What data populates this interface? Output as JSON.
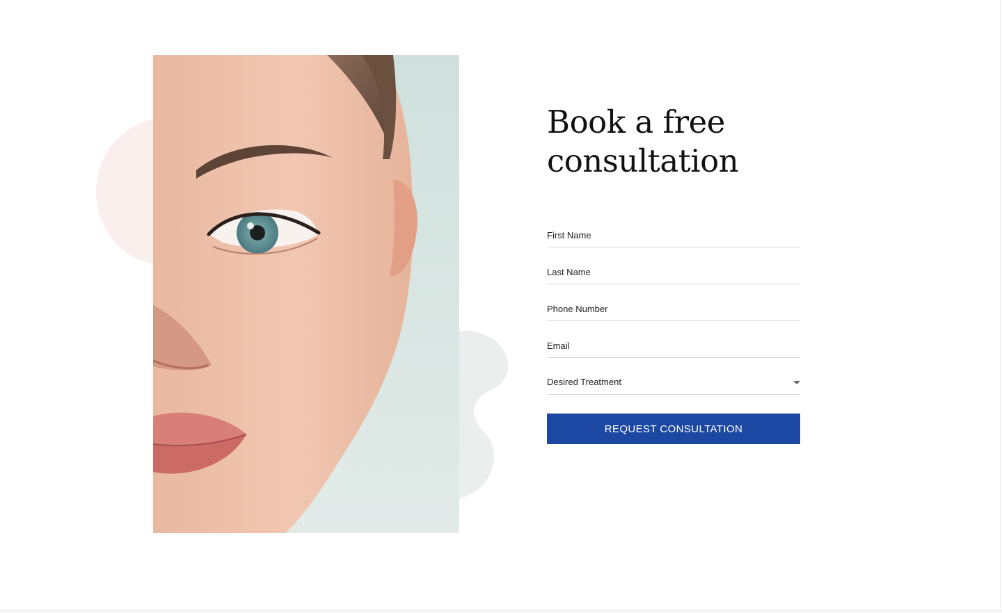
{
  "consultation": {
    "title_line1": "Book a free",
    "title_line2": "consultation",
    "fields": {
      "first_name": {
        "placeholder": "First Name",
        "value": ""
      },
      "last_name": {
        "placeholder": "Last Name",
        "value": ""
      },
      "phone": {
        "placeholder": "Phone Number",
        "value": ""
      },
      "email": {
        "placeholder": "Email",
        "value": ""
      },
      "treatment": {
        "label": "Desired Treatment"
      }
    },
    "submit_label": "REQUEST CONSULTATION"
  },
  "hero_image": {
    "alt": "Close-up portrait of a woman's face"
  },
  "icons": {
    "treatment_dropdown": "caret-down-icon"
  },
  "colors": {
    "accent": "#1c48a3",
    "blob_pink": "#fbefee",
    "blob_gray": "#eaeeed",
    "field_underline": "#d9d9d9",
    "text": "#111111"
  }
}
